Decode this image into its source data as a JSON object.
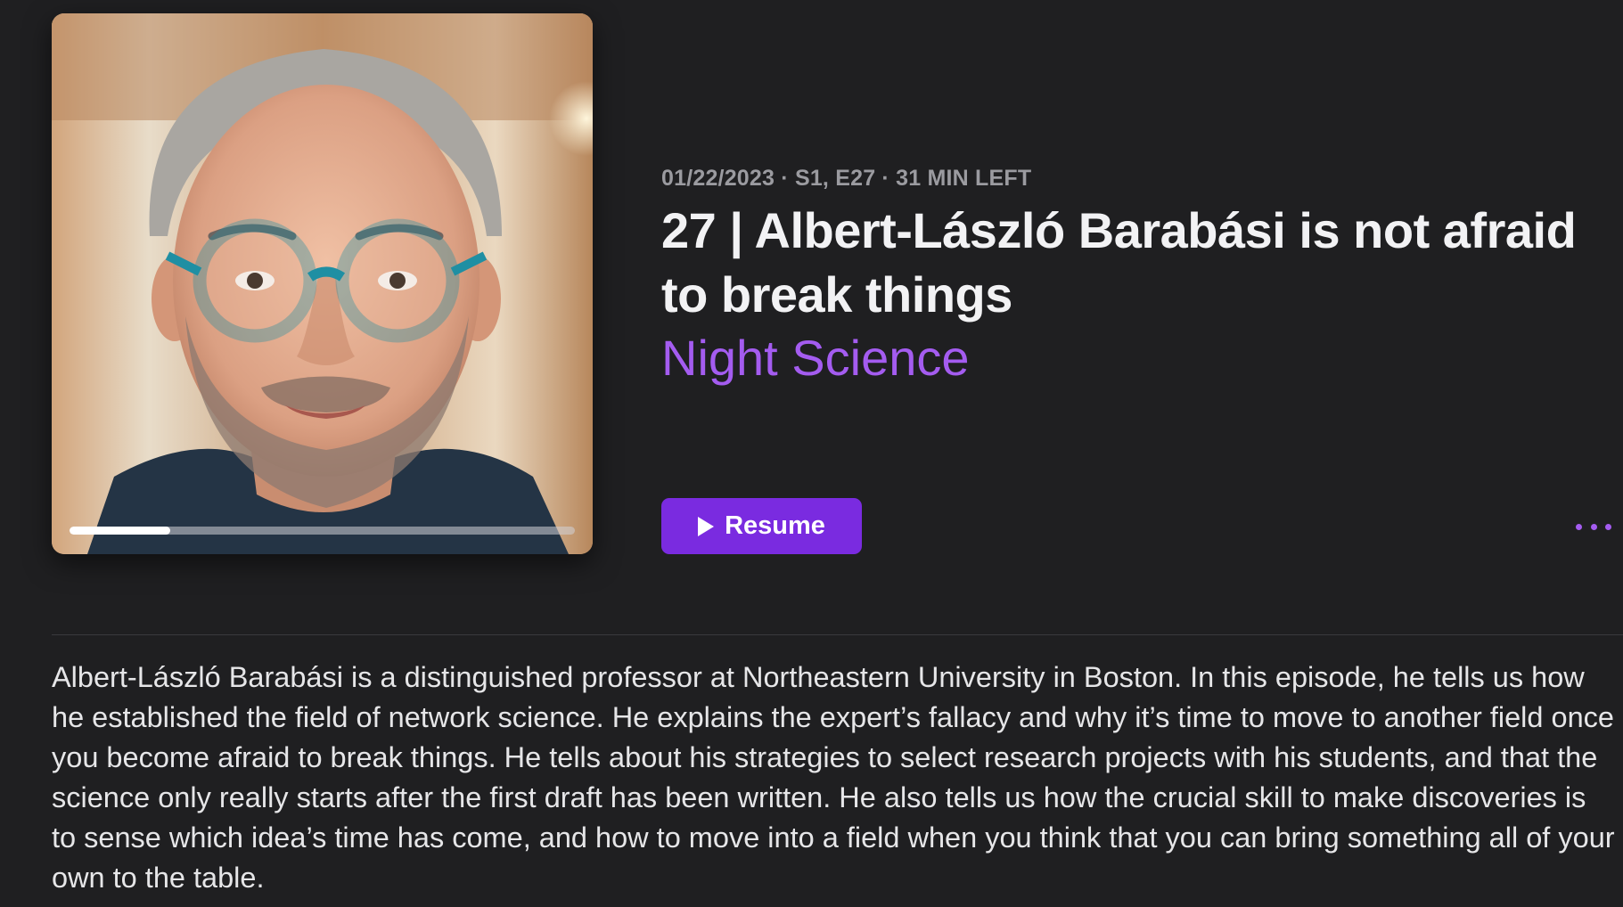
{
  "episode": {
    "meta": "01/22/2023 · S1, E27 · 31 MIN LEFT",
    "title": "27 | Albert-László Barabási is not afraid to break things",
    "show": "Night Science",
    "description": "Albert-László Barabási is a distinguished professor at Northeastern University in Boston. In this episode, he tells us how he established the field of network science. He explains the expert’s fallacy and why it’s time to move to another field once you become afraid to break things. He tells about his strategies to select research projects with his students, and that the science only really starts after the first draft has been written. He also tells us how the crucial skill to make discoveries is to sense which idea’s time has come, and how to move into a field when you think that you can bring something all of your own to the table.",
    "progress_fraction": 0.2
  },
  "actions": {
    "resume_label": "Resume",
    "play_icon": "play-icon",
    "more_icon": "ellipsis-icon"
  },
  "colors": {
    "background": "#1f1f21",
    "accent": "#a45cf0",
    "button": "#7a2be0",
    "meta_text": "#9b9ba0"
  }
}
